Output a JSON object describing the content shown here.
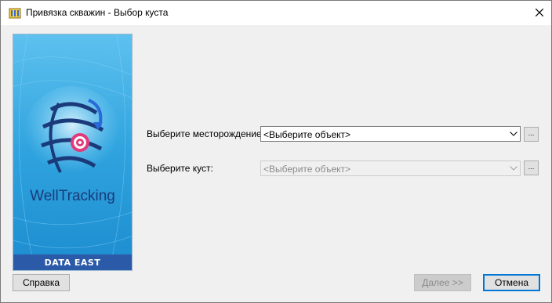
{
  "window": {
    "title": "Привязка скважин - Выбор куста",
    "icon": "well-app-icon",
    "close_icon": "close-icon"
  },
  "banner": {
    "brand": "WellTracking",
    "vendor": "DATA EAST",
    "colors": {
      "background": "#3aa8e0",
      "globe": "#1a3a7a",
      "target": "#e23a7a",
      "vendor_bar": "#2a5aa8"
    }
  },
  "form": {
    "field_label": "Выберите месторождение:",
    "field_value": "<Выберите объект>",
    "field_enabled": true,
    "cluster_label": "Выберите куст:",
    "cluster_value": "<Выберите объект>",
    "cluster_enabled": false,
    "browse_label": "..."
  },
  "buttons": {
    "help": "Справка",
    "next": "Далее >>",
    "next_enabled": false,
    "cancel": "Отмена"
  },
  "colors": {
    "focus_border": "#0078d7",
    "dialog_bg": "#f0f0f0"
  }
}
